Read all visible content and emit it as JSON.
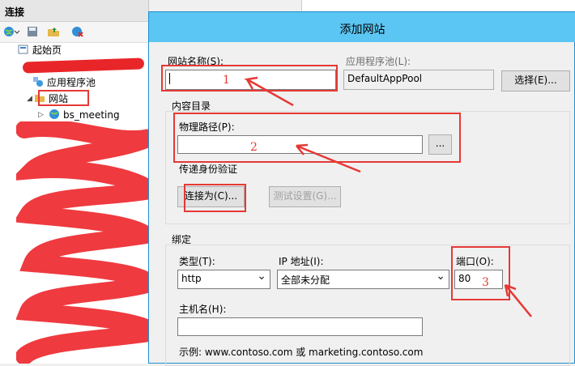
{
  "left_pane": {
    "title": "连接",
    "tree": {
      "start_page": "起始页",
      "app_pools": "应用程序池",
      "sites": "网站",
      "site_1": "bs_meeting"
    }
  },
  "dialog": {
    "title": "添加网站",
    "site_name": {
      "label": "网站名称(S):",
      "value": ""
    },
    "app_pool": {
      "label": "应用程序池(L):",
      "value": "DefaultAppPool",
      "select_button": "选择(E)..."
    },
    "content_dir": {
      "group_label": "内容目录",
      "physical_path": {
        "label": "物理路径(P):",
        "value": "",
        "browse_button": "..."
      },
      "pass_through_auth": "传递身份验证",
      "connect_as_button": "连接为(C)...",
      "test_settings_button": "测试设置(G)..."
    },
    "binding": {
      "group_label": "绑定",
      "type": {
        "label": "类型(T):",
        "value": "http"
      },
      "ip": {
        "label": "IP 地址(I):",
        "value": "全部未分配"
      },
      "port": {
        "label": "端口(O):",
        "value": "80"
      },
      "hostname": {
        "label": "主机名(H):",
        "value": ""
      },
      "example": "示例: www.contoso.com 或 marketing.contoso.com"
    }
  },
  "annotations": {
    "n1": "1",
    "n2": "2",
    "n3": "3",
    "color": "#e53935"
  },
  "colors": {
    "title_bar": "#5bc6f3",
    "dialog_border": "#1f8fd0"
  }
}
